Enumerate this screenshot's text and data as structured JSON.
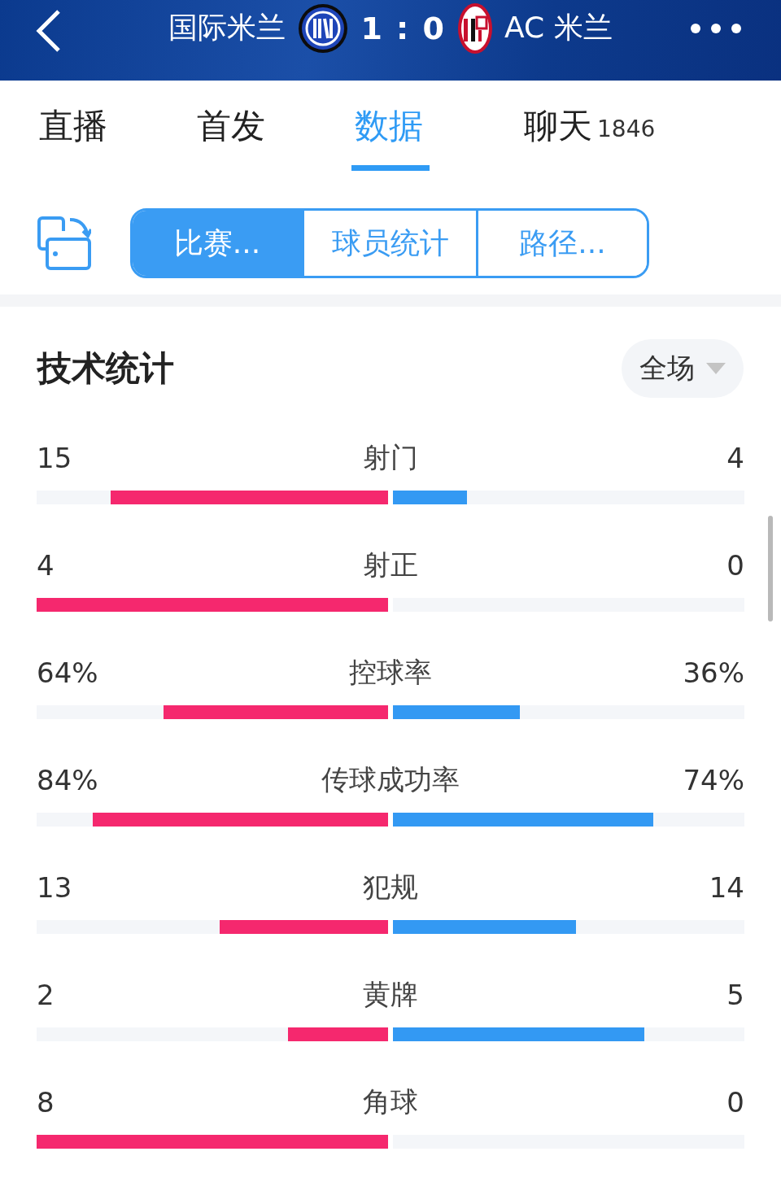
{
  "header": {
    "home_team": "国际米兰",
    "score": "1 : 0",
    "away_team": "AC 米兰"
  },
  "tabs": [
    {
      "label": "直播",
      "selected": false
    },
    {
      "label": "首发",
      "selected": false
    },
    {
      "label": "数据",
      "selected": true
    },
    {
      "label": "聊天",
      "count": "1846",
      "selected": false
    }
  ],
  "segments": [
    {
      "label": "比赛...",
      "selected": true
    },
    {
      "label": "球员统计",
      "selected": false
    },
    {
      "label": "路径...",
      "selected": false
    }
  ],
  "section": {
    "title": "技术统计",
    "period": "全场"
  },
  "stats": [
    {
      "label": "射门",
      "home": {
        "value": "15",
        "level": 0.79
      },
      "away": {
        "value": "4",
        "level": 0.21
      }
    },
    {
      "label": "射正",
      "home": {
        "value": "4",
        "level": 1
      },
      "away": {
        "value": "0",
        "level": 0
      }
    },
    {
      "label": "控球率",
      "home": {
        "value": "64%",
        "level": 0.64
      },
      "away": {
        "value": "36%",
        "level": 0.36
      }
    },
    {
      "label": "传球成功率",
      "home": {
        "value": "84%",
        "level": 0.84
      },
      "away": {
        "value": "74%",
        "level": 0.74
      }
    },
    {
      "label": "犯规",
      "home": {
        "value": "13",
        "level": 0.48
      },
      "away": {
        "value": "14",
        "level": 0.52
      }
    },
    {
      "label": "黄牌",
      "home": {
        "value": "2",
        "level": 0.285
      },
      "away": {
        "value": "5",
        "level": 0.715
      }
    },
    {
      "label": "角球",
      "home": {
        "value": "8",
        "level": 1
      },
      "away": {
        "value": "0",
        "level": 0
      }
    }
  ]
}
